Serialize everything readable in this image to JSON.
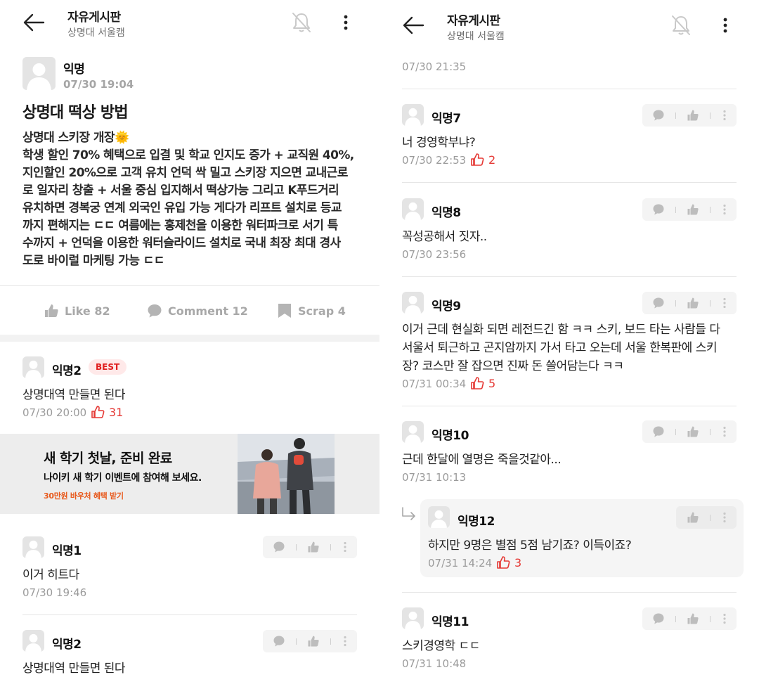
{
  "header": {
    "board_title": "자유게시판",
    "board_subtitle": "상명대 서울캠"
  },
  "post": {
    "author": "익명",
    "date": "07/30 19:04",
    "title": "상명대 떡상 방법",
    "body_lines": [
      "상명대 스키장 개장🌞",
      "학생 할인 70% 혜택으로 입결 및 학교 인지도 증가 + 교직원 40%,",
      "지인할인 20%으로 고객 유치 언덕 싹 밀고 스키장 지으면 교내근로",
      "로 일자리 창출 + 서울 중심 입지해서 떡상가능 그리고 K푸드거리",
      "유치하면 경복궁 연계 외국인 유입 가능 게다가 리프트 설치로 등교",
      "까지 편해지는 ㄷㄷ 여름에는 홍제천을 이용한 워터파크로 서기 특",
      "수까지 + 언덕을 이용한 워터슬라이드 설치로 국내 최장 최대 경사",
      "도로 바이럴 마케팅 가능 ㄷㄷ"
    ],
    "actions": {
      "like": "Like 82",
      "comment": "Comment 12",
      "scrap": "Scrap 4"
    }
  },
  "best_comment": {
    "author": "익명2",
    "badge": "BEST",
    "text": "상명대역 만들면 된다",
    "date": "07/30 20:00",
    "likes": "31"
  },
  "ad": {
    "headline": "새 학기 첫날, 준비 완료",
    "subline": "나이키 새 학기 이벤트에 참여해 보세요.",
    "cta": "30만원 바우처 혜택 받기"
  },
  "left_comments": [
    {
      "author": "익명1",
      "text": "이거 히트다",
      "date": "07/30 19:46"
    },
    {
      "author": "익명2",
      "text": "상명대역 만들면 된다"
    }
  ],
  "right_comments": {
    "top_date": "07/30 21:35",
    "c7": {
      "author": "익명7",
      "text": "너 경영학부냐?",
      "date": "07/30 22:53",
      "likes": "2"
    },
    "c8": {
      "author": "익명8",
      "text": "꼭성공해서 짓자..",
      "date": "07/30 23:56"
    },
    "c9": {
      "author": "익명9",
      "lines": [
        "이거 근데 현실화 되면 레전드긴 함 ㅋㅋ 스키, 보드 타는 사람들 다",
        "서울서 퇴근하고 곤지암까지 가서 타고 오는데 서울 한복판에 스키",
        "장? 코스만 잘 잡으면 진짜 돈 쓸어담는다 ㅋㅋ"
      ],
      "date": "07/31 00:34",
      "likes": "5"
    },
    "c10": {
      "author": "익명10",
      "text": "근데 한달에 열명은 죽을것같아...",
      "date": "07/31 10:13"
    },
    "reply12": {
      "author": "익명12",
      "text": "하지만 9명은 별점 5점 남기죠? 이득이죠?",
      "date": "07/31 14:24",
      "likes": "3"
    },
    "c11": {
      "author": "익명11",
      "text": "스키경영학 ㄷㄷ",
      "date": "07/31 10:48"
    }
  }
}
